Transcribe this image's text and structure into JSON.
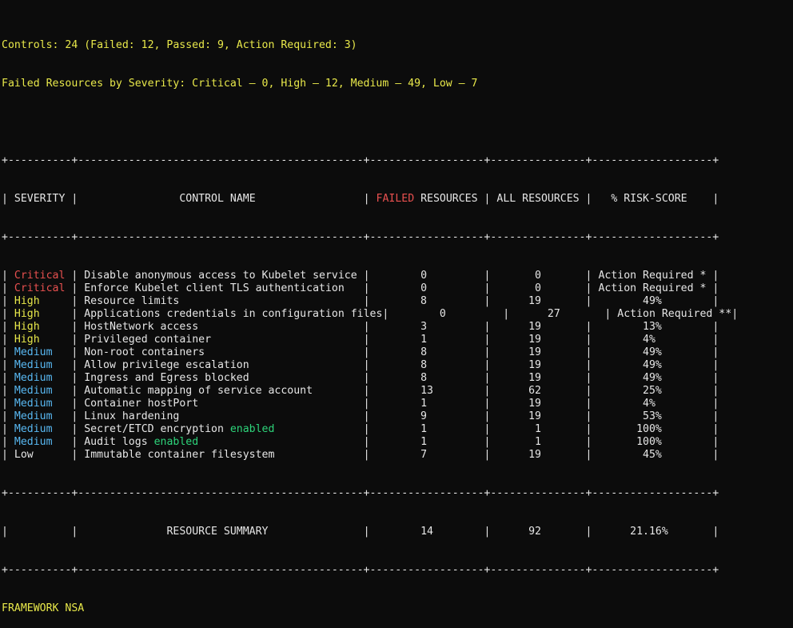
{
  "summary": {
    "controls_line": "Controls: 24 (Failed: 12, Passed: 9, Action Required: 3)",
    "severity_line": "Failed Resources by Severity: Critical — 0, High — 12, Medium — 49, Low — 7"
  },
  "table": {
    "border_top": "+----------+---------------------------------------------+------------------+---------------+-------------------+",
    "border_mid": "+----------+---------------------------------------------+------------------+---------------+-------------------+",
    "headers": {
      "severity": "SEVERITY",
      "control_name": "CONTROL NAME",
      "failed_word": "FAILED",
      "failed_rest": "RESOURCES",
      "all_resources": "ALL RESOURCES",
      "risk_score": "% RISK-SCORE"
    },
    "rows": [
      {
        "severity": "Critical",
        "severity_color": "#e8504f",
        "control": "Disable anonymous access to Kubelet service",
        "control_suffix": "",
        "failed": "0",
        "all": "0",
        "risk": "Action Required *"
      },
      {
        "severity": "Critical",
        "severity_color": "#e8504f",
        "control": "Enforce Kubelet client TLS authentication",
        "control_suffix": "",
        "failed": "0",
        "all": "0",
        "risk": "Action Required *"
      },
      {
        "severity": "High",
        "severity_color": "#e8e84a",
        "control": "Resource limits",
        "control_suffix": "",
        "failed": "8",
        "all": "19",
        "risk": "49%"
      },
      {
        "severity": "High",
        "severity_color": "#e8e84a",
        "control": "Applications credentials in configuration files",
        "control_suffix": "",
        "failed": "0",
        "all": "27",
        "risk": "Action Required **"
      },
      {
        "severity": "High",
        "severity_color": "#e8e84a",
        "control": "HostNetwork access",
        "control_suffix": "",
        "failed": "3",
        "all": "19",
        "risk": "13%"
      },
      {
        "severity": "High",
        "severity_color": "#e8e84a",
        "control": "Privileged container",
        "control_suffix": "",
        "failed": "1",
        "all": "19",
        "risk": "4%"
      },
      {
        "severity": "Medium",
        "severity_color": "#58b8f2",
        "control": "Non-root containers",
        "control_suffix": "",
        "failed": "8",
        "all": "19",
        "risk": "49%"
      },
      {
        "severity": "Medium",
        "severity_color": "#58b8f2",
        "control": "Allow privilege escalation",
        "control_suffix": "",
        "failed": "8",
        "all": "19",
        "risk": "49%"
      },
      {
        "severity": "Medium",
        "severity_color": "#58b8f2",
        "control": "Ingress and Egress blocked",
        "control_suffix": "",
        "failed": "8",
        "all": "19",
        "risk": "49%"
      },
      {
        "severity": "Medium",
        "severity_color": "#58b8f2",
        "control": "Automatic mapping of service account",
        "control_suffix": "",
        "failed": "13",
        "all": "62",
        "risk": "25%"
      },
      {
        "severity": "Medium",
        "severity_color": "#58b8f2",
        "control": "Container hostPort",
        "control_suffix": "",
        "failed": "1",
        "all": "19",
        "risk": "4%"
      },
      {
        "severity": "Medium",
        "severity_color": "#58b8f2",
        "control": "Linux hardening",
        "control_suffix": "",
        "failed": "9",
        "all": "19",
        "risk": "53%"
      },
      {
        "severity": "Medium",
        "severity_color": "#58b8f2",
        "control": "Secret/ETCD encryption",
        "control_suffix": "enabled",
        "failed": "1",
        "all": "1",
        "risk": "100%"
      },
      {
        "severity": "Medium",
        "severity_color": "#58b8f2",
        "control": "Audit logs",
        "control_suffix": "enabled",
        "failed": "1",
        "all": "1",
        "risk": "100%"
      },
      {
        "severity": "Low",
        "severity_color": "#e6e6e6",
        "control": "Immutable container filesystem",
        "control_suffix": "",
        "failed": "7",
        "all": "19",
        "risk": "45%"
      }
    ],
    "summary_row": {
      "label": "RESOURCE SUMMARY",
      "failed": "14",
      "all": "92",
      "risk": "21.16%"
    }
  },
  "footer": {
    "framework": "FRAMEWORK NSA"
  },
  "colors": {
    "background": "#0c0c0c",
    "text": "#e6e6e6",
    "yellow": "#e8e84a",
    "red": "#e8504f",
    "cyan": "#58b8f2",
    "green": "#2dd47a"
  }
}
